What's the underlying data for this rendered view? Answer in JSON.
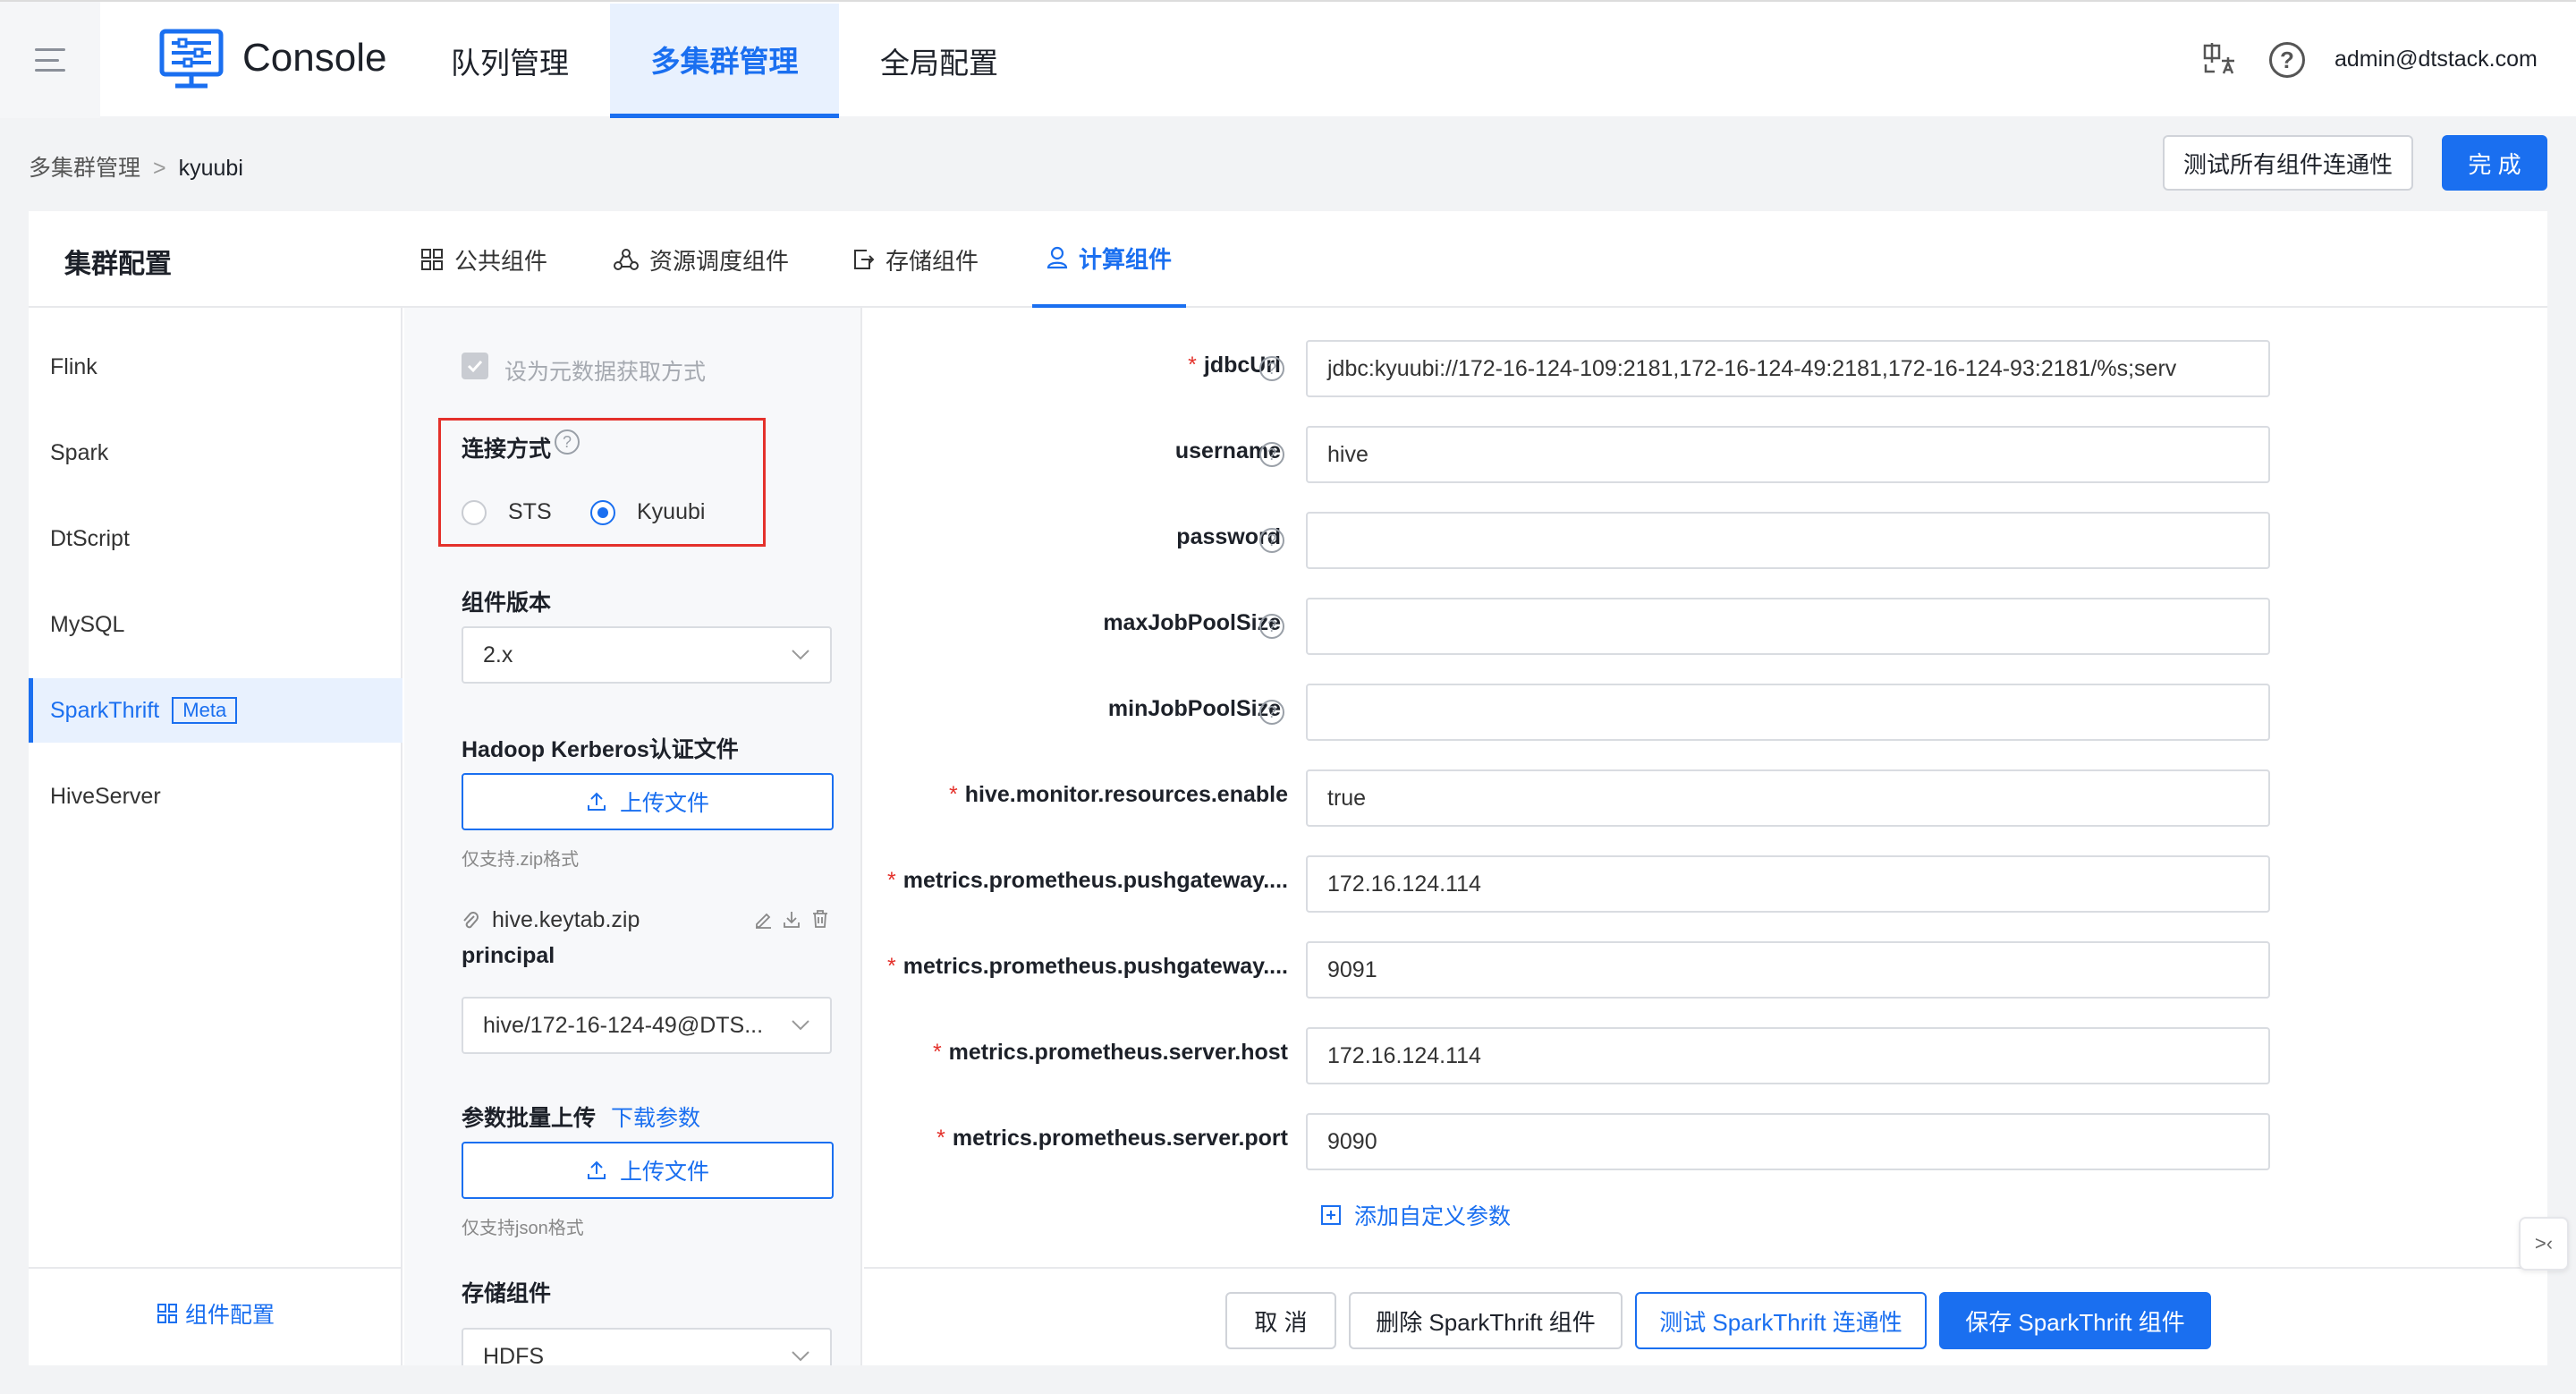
{
  "topbar": {
    "brand": "Console",
    "tabs": [
      {
        "label": "队列管理",
        "active": false
      },
      {
        "label": "多集群管理",
        "active": true
      },
      {
        "label": "全局配置",
        "active": false
      }
    ],
    "help_glyph": "?",
    "user": "admin@dtstack.com"
  },
  "breadcrumb": {
    "parent": "多集群管理",
    "separator": ">",
    "current": "kyuubi"
  },
  "actions": {
    "test_all": "测试所有组件连通性",
    "done": "完 成"
  },
  "card": {
    "title": "集群配置",
    "tabs": [
      {
        "label": "公共组件",
        "icon": "grid-icon",
        "active": false
      },
      {
        "label": "资源调度组件",
        "icon": "cluster-icon",
        "active": false
      },
      {
        "label": "存储组件",
        "icon": "storage-icon",
        "active": false
      },
      {
        "label": "计算组件",
        "icon": "user-icon",
        "active": true
      }
    ]
  },
  "sidebar": {
    "items": [
      {
        "label": "Flink",
        "active": false
      },
      {
        "label": "Spark",
        "active": false
      },
      {
        "label": "DtScript",
        "active": false
      },
      {
        "label": "MySQL",
        "active": false
      },
      {
        "label": "SparkThrift",
        "tag": "Meta",
        "active": true
      },
      {
        "label": "HiveServer",
        "active": false
      }
    ],
    "footer": "组件配置"
  },
  "mid": {
    "metadata_checkbox": "设为元数据获取方式",
    "metadata_checked": true,
    "connect_label": "连接方式",
    "connect_options": [
      "STS",
      "Kyuubi"
    ],
    "connect_selected": "Kyuubi",
    "version_label": "组件版本",
    "version_value": "2.x",
    "kerberos_label": "Hadoop Kerberos认证文件",
    "upload_label": "上传文件",
    "zip_hint": "仅支持.zip格式",
    "keytab_file": "hive.keytab.zip",
    "principal_label": "principal",
    "principal_value": "hive/172-16-124-49@DTS...",
    "batch_label": "参数批量上传",
    "download_link": "下载参数",
    "upload_label2": "上传文件",
    "json_hint": "仅支持json格式",
    "storage_label": "存储组件",
    "storage_value": "HDFS"
  },
  "form": {
    "fields": [
      {
        "label": "jdbcUrl",
        "required": true,
        "help": true,
        "value": "jdbc:kyuubi://172-16-124-109:2181,172-16-124-49:2181,172-16-124-93:2181/%s;serv"
      },
      {
        "label": "username",
        "required": false,
        "help": true,
        "value": "hive"
      },
      {
        "label": "password",
        "required": false,
        "help": true,
        "value": ""
      },
      {
        "label": "maxJobPoolSize",
        "required": false,
        "help": true,
        "value": ""
      },
      {
        "label": "minJobPoolSize",
        "required": false,
        "help": true,
        "value": ""
      },
      {
        "label": "hive.monitor.resources.enable",
        "required": true,
        "help": false,
        "value": "true"
      },
      {
        "label": "metrics.prometheus.pushgateway....",
        "required": true,
        "help": false,
        "value": "172.16.124.114"
      },
      {
        "label": "metrics.prometheus.pushgateway....",
        "required": true,
        "help": false,
        "value": "9091"
      },
      {
        "label": "metrics.prometheus.server.host",
        "required": true,
        "help": false,
        "value": "172.16.124.114"
      },
      {
        "label": "metrics.prometheus.server.port",
        "required": true,
        "help": false,
        "value": "9090"
      }
    ],
    "add_custom": "添加自定义参数"
  },
  "footer": {
    "cancel": "取 消",
    "delete": "删除 SparkThrift 组件",
    "test": "测试 SparkThrift 连通性",
    "save": "保存 SparkThrift 组件"
  },
  "side_handle": ">‹",
  "colors": {
    "primary": "#1a6ff0",
    "required": "#e4312b",
    "highlight_border": "#e4312b"
  }
}
